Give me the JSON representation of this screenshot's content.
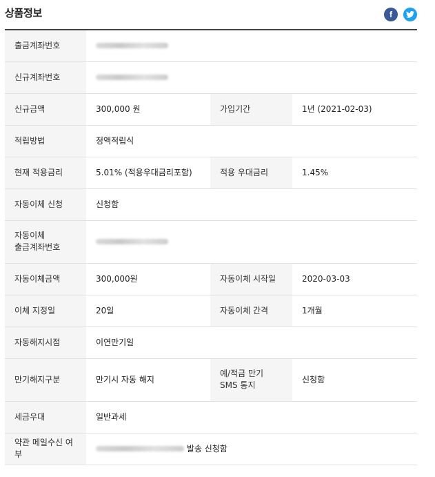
{
  "header": {
    "title": "상품정보"
  },
  "rows": [
    {
      "label": "출금계좌번호",
      "value": ""
    },
    {
      "label": "신규계좌번호",
      "value": ""
    },
    {
      "label": "신규금액",
      "value": "300,000 원",
      "label2": "가입기간",
      "value2": "1년 (2021-02-03)"
    },
    {
      "label": "적립방법",
      "value": "정액적립식"
    },
    {
      "label": "현재 적용금리",
      "value": "5.01% (적용우대금리포함)",
      "label2": "적용 우대금리",
      "value2": "1.45%"
    },
    {
      "label": "자동이체 신청",
      "value": "신청함"
    },
    {
      "label_line1": "자동이체",
      "label_line2": "출금계좌번호",
      "value": ""
    },
    {
      "label": "자동이체금액",
      "value": "300,000원",
      "label2": "자동이체 시작일",
      "value2": "2020-03-03"
    },
    {
      "label": "이체 지정일",
      "value": "20일",
      "label2": "자동이체 간격",
      "value2": "1개월"
    },
    {
      "label": "자동해지시점",
      "value": "이연만기일"
    },
    {
      "label": "만기해지구분",
      "value": "만기시 자동 해지",
      "label2_line1": "예/적금 만기",
      "label2_line2": "SMS 통지",
      "value2": "신청함"
    },
    {
      "label": "세금우대",
      "value": "일반과세"
    },
    {
      "label": "약관 메일수신 여부",
      "value": "발송 신청함"
    }
  ],
  "icons": {
    "facebook": "facebook-icon",
    "twitter": "twitter-icon"
  },
  "colors": {
    "facebook": "#3b5998",
    "twitter": "#1da1f2",
    "label_bg": "#f5f5f5"
  }
}
